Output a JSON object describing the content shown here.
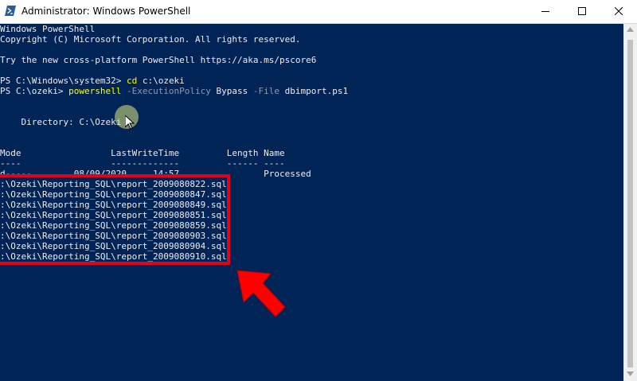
{
  "window": {
    "title": "Administrator: Windows PowerShell",
    "app_icon": "powershell-icon",
    "controls": [
      "minimize-icon",
      "maximize-icon",
      "close-icon"
    ]
  },
  "console": {
    "background": "#012456",
    "header_lines": [
      "Windows PowerShell",
      "Copyright (C) Microsoft Corporation. All rights reserved.",
      "",
      "Try the new cross-platform PowerShell https://aka.ms/pscore6",
      ""
    ],
    "cmd1": {
      "prompt": "PS C:\\Windows\\system32> ",
      "command": "cd",
      "args": " c:\\ozeki"
    },
    "cmd2": {
      "prompt": "PS C:\\ozeki> ",
      "command": "powershell",
      "param1": "-ExecutionPolicy",
      "value1": " Bypass ",
      "param2": "-File",
      "value2": " dbimport.ps1"
    },
    "directory_line": "    Directory: C:\\Ozeki",
    "table_header": "Mode                 LastWriteTime         Length Name",
    "table_separator": "----                 -------------         ------ ----",
    "table_row": "d-----        08/09/2020     14:57                Processed",
    "file_lines": [
      ":\\Ozeki\\Reporting_SQL\\report_2009080822.sql",
      ":\\Ozeki\\Reporting_SQL\\report_2009080847.sql",
      ":\\Ozeki\\Reporting_SQL\\report_2009080849.sql",
      ":\\Ozeki\\Reporting_SQL\\report_2009080851.sql",
      ":\\Ozeki\\Reporting_SQL\\report_2009080859.sql",
      ":\\Ozeki\\Reporting_SQL\\report_2009080903.sql",
      ":\\Ozeki\\Reporting_SQL\\report_2009080904.sql",
      ":\\Ozeki\\Reporting_SQL\\report_2009080910.sql"
    ]
  },
  "annotations": {
    "highlight_color": "#e3001b",
    "arrow_icon": "red-arrow-icon",
    "cursor_icon": "mouse-cursor-icon"
  }
}
